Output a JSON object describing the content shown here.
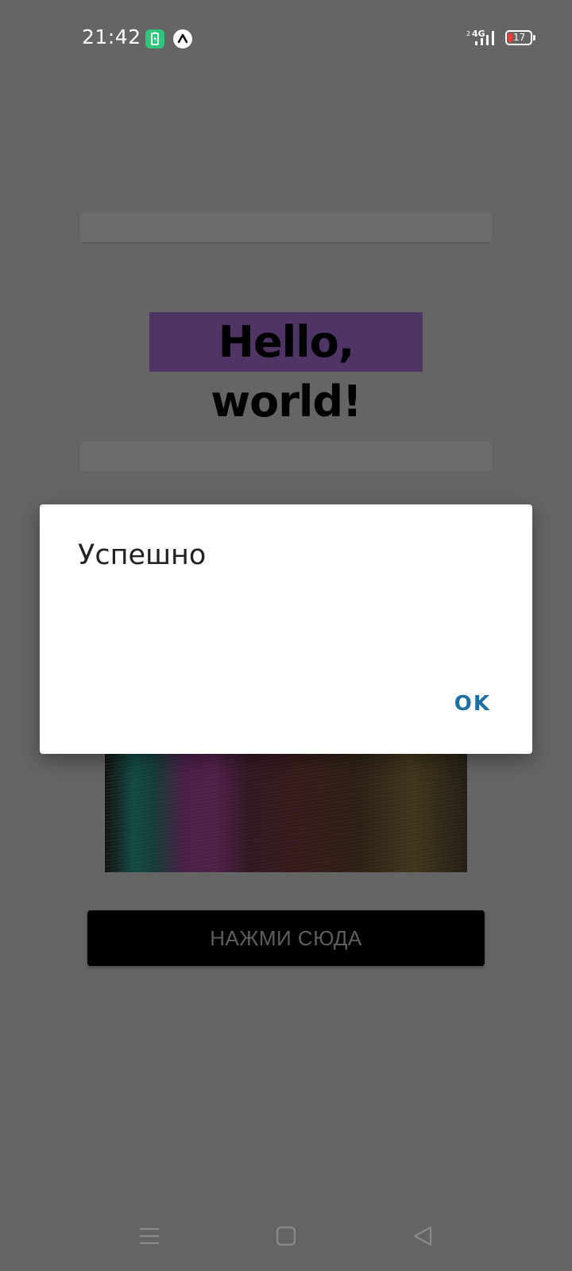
{
  "status_bar": {
    "time": "21:42",
    "network_type": "4G",
    "sim_indicator": "2",
    "battery_level": "17",
    "icons": [
      "battery-app-icon",
      "expo-icon",
      "signal-icon",
      "battery-icon"
    ]
  },
  "app": {
    "heading": "Hello, world!",
    "button_label": "НАЖМИ СЮДА",
    "heading_background": "#4f3566",
    "button_background": "#000000"
  },
  "dialog": {
    "title": "Успешно",
    "ok_label": "OK",
    "accent_color": "#1e6fa3"
  },
  "nav_bar": {
    "icons": [
      "menu-icon",
      "home-icon",
      "back-icon"
    ]
  }
}
